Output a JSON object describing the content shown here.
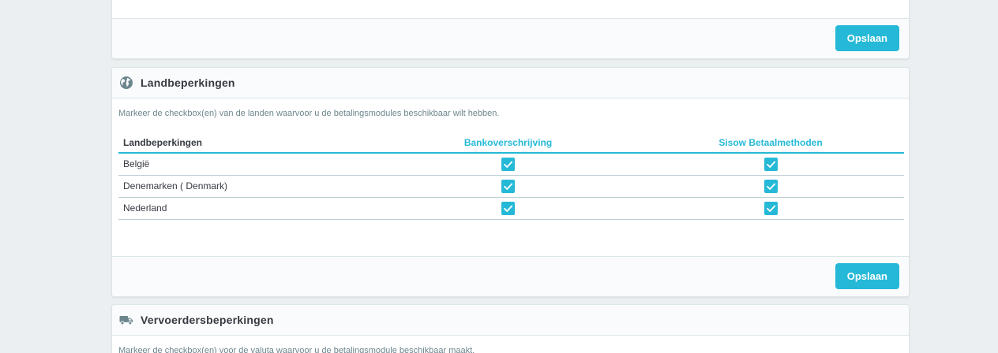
{
  "top_panel": {
    "save_label": "Opslaan"
  },
  "country_panel": {
    "title": "Landbeperkingen",
    "help_text": "Markeer de checkbox(en) van de landen waarvoor u de betalingsmodules beschikbaar wilt hebben.",
    "columns": [
      "Landbeperkingen",
      "Bankoverschrijving",
      "Sisow Betaalmethoden"
    ],
    "rows": [
      {
        "name": "België",
        "checks": [
          true,
          true
        ]
      },
      {
        "name": "Denemarken ( Denmark)",
        "checks": [
          true,
          true
        ]
      },
      {
        "name": "Nederland",
        "checks": [
          true,
          true
        ]
      }
    ],
    "save_label": "Opslaan",
    "icon": "globe-icon"
  },
  "carrier_panel": {
    "title": "Vervoerdersbeperkingen",
    "help_text": "Markeer de checkbox(en) voor de valuta waarvoor u de betalingsmodule beschikbaar maakt.",
    "icon": "truck-icon"
  },
  "colors": {
    "accent": "#25b9d7",
    "background": "#eceff1",
    "text": "#363a41"
  }
}
